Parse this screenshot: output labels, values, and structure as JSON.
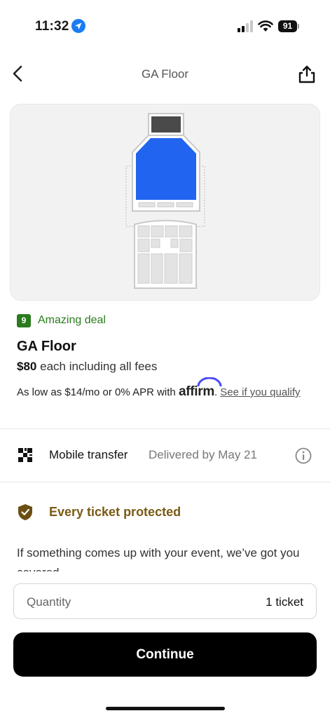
{
  "status_bar": {
    "time": "11:32",
    "battery": "91"
  },
  "nav": {
    "title": "GA Floor"
  },
  "listing": {
    "deal_score": "9",
    "deal_label": "Amazing deal",
    "section": "GA Floor",
    "price": "$80",
    "price_suffix": "each including all fees",
    "financing_prefix": "As low as $14/mo or 0% APR with",
    "financing_brand": "affirm",
    "financing_link": "See if you qualify"
  },
  "delivery": {
    "method": "Mobile transfer",
    "date": "Delivered by May 21"
  },
  "protection": {
    "title": "Every ticket protected",
    "text": "If something comes up with your event, we’ve got you covered"
  },
  "checkout": {
    "quantity_label": "Quantity",
    "quantity_value": "1 ticket",
    "continue_label": "Continue"
  },
  "colors": {
    "highlight": "#2064f0",
    "deal_green": "#2a7a1e",
    "protect_gold": "#7a5a14"
  }
}
